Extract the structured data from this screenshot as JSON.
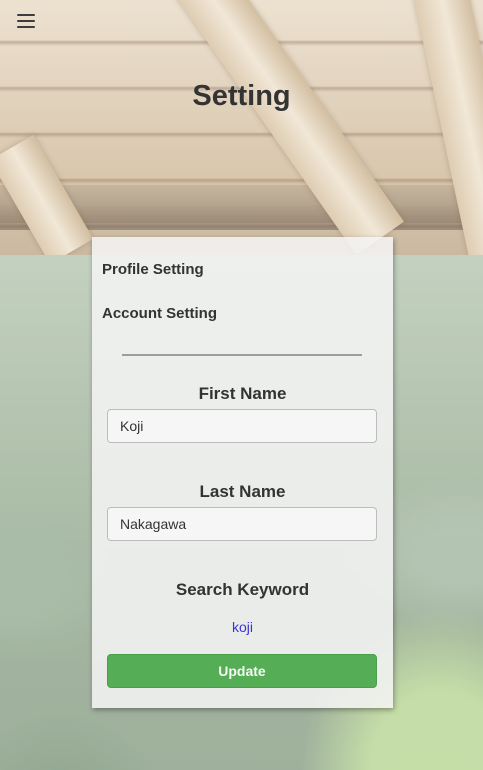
{
  "header": {
    "title": "Setting",
    "menu_icon": "hamburger-menu-icon"
  },
  "settings_nav": {
    "items": [
      {
        "label": "Profile Setting"
      },
      {
        "label": "Account Setting"
      }
    ]
  },
  "form": {
    "first_name": {
      "label": "First Name",
      "value": "Koji"
    },
    "last_name": {
      "label": "Last Name",
      "value": "Nakagawa"
    },
    "search_keyword": {
      "label": "Search Keyword",
      "value": "koji"
    },
    "update_label": "Update"
  },
  "colors": {
    "title_text": "#333333",
    "update_button": "#55ad55",
    "keyword_link": "#3a33d6",
    "panel_background": "#f4f4f4"
  }
}
